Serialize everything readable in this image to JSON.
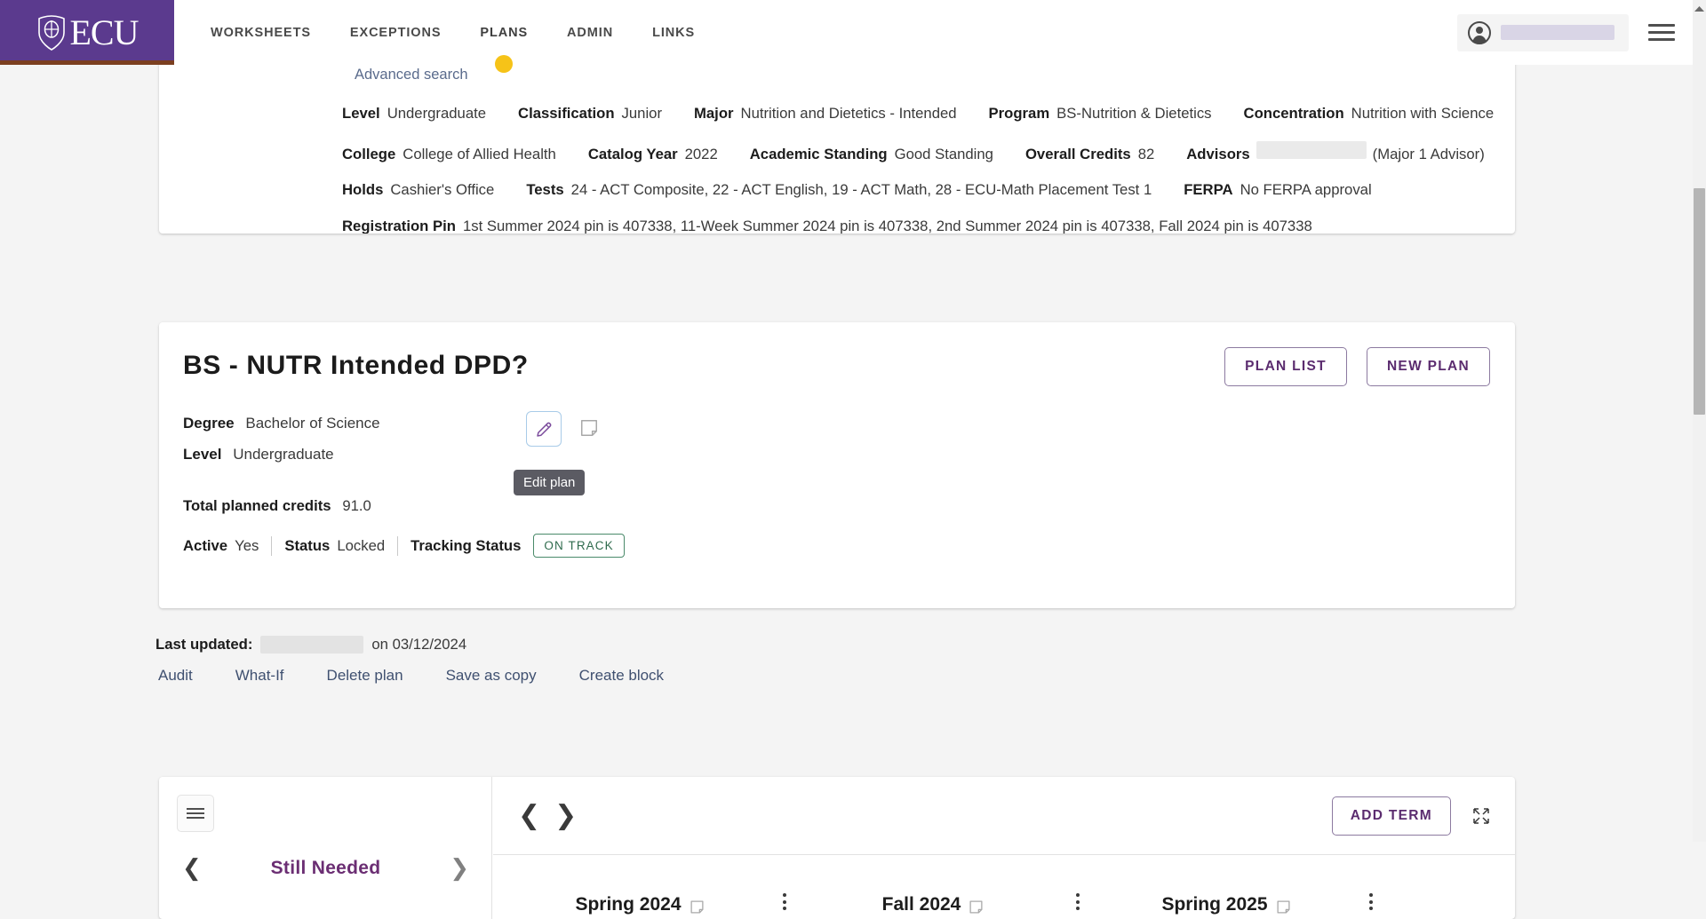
{
  "header": {
    "brand": "ECU",
    "brand_icon": "ecu-shield-logo",
    "tabs": [
      {
        "label": "WORKSHEETS",
        "active": false
      },
      {
        "label": "EXCEPTIONS",
        "active": false
      },
      {
        "label": "PLANS",
        "active": true
      },
      {
        "label": "ADMIN",
        "active": false
      },
      {
        "label": "LINKS",
        "active": false
      }
    ],
    "user_name_redacted": "",
    "avatar_icon": "user-avatar-icon",
    "menu_icon": "hamburger-menu-icon",
    "accent_gold": "#edc843",
    "brand_purple": "#5b3a8e"
  },
  "student": {
    "advanced_search": "Advanced search",
    "rows": [
      [
        {
          "label": "Level",
          "value": "Undergraduate"
        },
        {
          "label": "Classification",
          "value": "Junior"
        },
        {
          "label": "Major",
          "value": "Nutrition and Dietetics - Intended"
        },
        {
          "label": "Program",
          "value": "BS-Nutrition & Dietetics"
        },
        {
          "label": "Concentration",
          "value": "Nutrition with Science"
        }
      ],
      [
        {
          "label": "College",
          "value": "College of Allied Health"
        },
        {
          "label": "Catalog Year",
          "value": "2022"
        },
        {
          "label": "Academic Standing",
          "value": "Good Standing"
        },
        {
          "label": "Overall Credits",
          "value": "82"
        },
        {
          "label": "Advisors",
          "value": "(Major 1 Advisor)"
        }
      ],
      [
        {
          "label": "Holds",
          "value": "Cashier's Office"
        },
        {
          "label": "Tests",
          "value": "24 - ACT Composite, 22 - ACT English, 19 - ACT Math, 28 - ECU-Math Placement Test 1"
        },
        {
          "label": "FERPA",
          "value": "No FERPA approval"
        }
      ],
      [
        {
          "label": "Registration Pin",
          "value": "1st Summer 2024 pin is 407338, 11-Week Summer 2024 pin is 407338, 2nd Summer 2024 pin is 407338, Fall 2024 pin is 407338"
        }
      ]
    ]
  },
  "plan": {
    "title": "BS - NUTR Intended DPD?",
    "edit_icon": "pencil-icon",
    "edit_tooltip": "Edit plan",
    "note_icon": "note-icon",
    "plan_list_label": "PLAN LIST",
    "new_plan_label": "NEW PLAN",
    "degree_label": "Degree",
    "degree_value": "Bachelor of Science",
    "level_label": "Level",
    "level_value": "Undergraduate",
    "total_credits_label": "Total planned credits",
    "total_credits_value": "91.0",
    "active_label": "Active",
    "active_value": "Yes",
    "status_label": "Status",
    "status_value": "Locked",
    "tracking_label": "Tracking Status",
    "tracking_badge": "ON TRACK",
    "tracking_color": "#2f6b4d"
  },
  "footer": {
    "last_updated_label": "Last updated:",
    "last_updated_on": "on 03/12/2024",
    "links": [
      "Audit",
      "What-If",
      "Delete plan",
      "Save as copy",
      "Create block"
    ]
  },
  "bottom": {
    "menu_icon": "hamburger-menu-icon",
    "still_needed_title": "Still Needed",
    "prev_icon": "chevron-left-icon",
    "next_icon": "chevron-right-icon",
    "add_term_label": "ADD TERM",
    "expand_icon": "expand-collapse-icon",
    "terms": [
      {
        "name": "Spring 2024",
        "note_icon": "note-icon",
        "menu_icon": "kebab-menu-icon"
      },
      {
        "name": "Fall 2024",
        "note_icon": "note-icon",
        "menu_icon": "kebab-menu-icon"
      },
      {
        "name": "Spring 2025",
        "note_icon": "note-icon",
        "menu_icon": "kebab-menu-icon"
      }
    ]
  }
}
